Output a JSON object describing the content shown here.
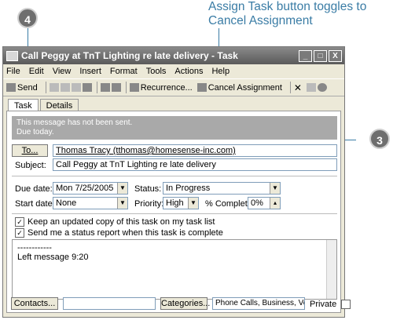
{
  "callout": {
    "line1": "Assign Task button toggles to",
    "line2": "Cancel Assignment",
    "step4": "4",
    "step3": "3"
  },
  "window": {
    "title": "Call Peggy at TnT Lighting re late delivery - Task",
    "buttons": [
      "_",
      "□",
      "X"
    ]
  },
  "menu": [
    "File",
    "Edit",
    "View",
    "Insert",
    "Format",
    "Tools",
    "Actions",
    "Help"
  ],
  "toolbar": {
    "send": "Send",
    "recurrence": "Recurrence...",
    "cancel_assignment": "Cancel Assignment"
  },
  "tabs": [
    "Task",
    "Details"
  ],
  "info": {
    "line1": "This message has not been sent.",
    "line2": "Due today."
  },
  "form": {
    "to_button": "To...",
    "to_value": "Thomas Tracy (tthomas@homesense-inc.com)",
    "subject_label": "Subject:",
    "subject_value": "Call Peggy at TnT Lighting re late delivery",
    "due_label": "Due date:",
    "due_value": "Mon 7/25/2005",
    "start_label": "Start date:",
    "start_value": "None",
    "status_label": "Status:",
    "status_value": "In Progress",
    "priority_label": "Priority:",
    "priority_value": "High",
    "complete_label": "% Complete:",
    "complete_value": "0%",
    "keep_copy": "Keep an updated copy of this task on my task list",
    "send_status": "Send me a status report when this task is complete"
  },
  "notes": {
    "dashes": "------------",
    "text": "Left message 9:20"
  },
  "bottom": {
    "contacts": "Contacts...",
    "categories": "Categories...",
    "categories_value": "Phone Calls, Business, Vendors",
    "private": "Private"
  },
  "colors": {
    "callout": "#3a7ca5",
    "info_bg": "#a9a9a9",
    "window_bg": "#ece9d8"
  }
}
